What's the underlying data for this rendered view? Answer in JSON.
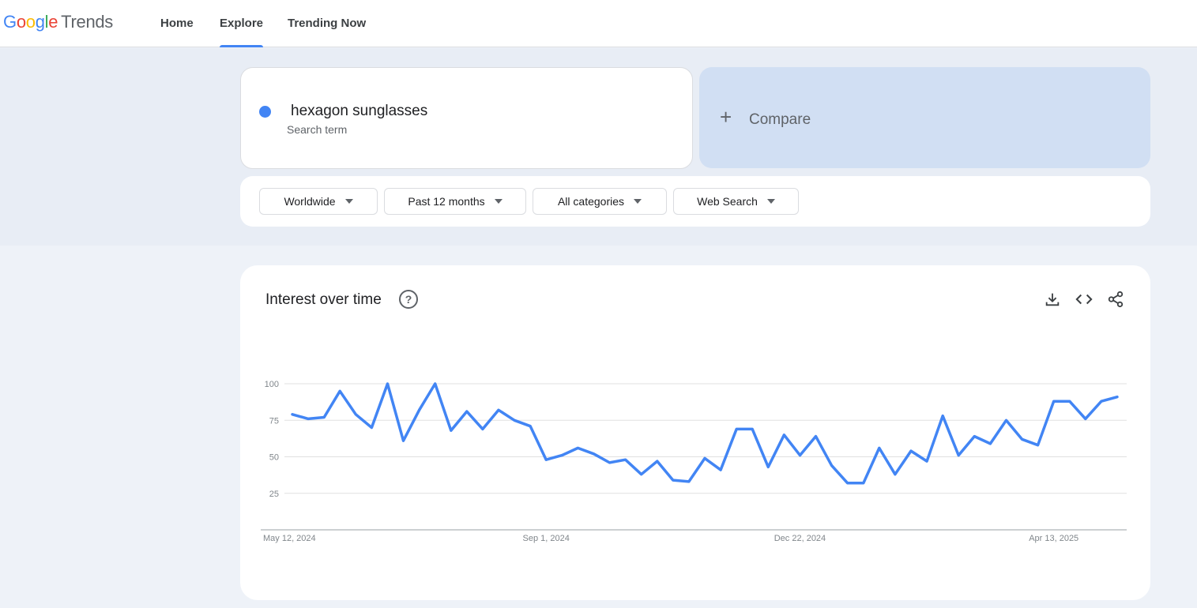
{
  "header": {
    "logo_google": "Google",
    "logo_trends": "Trends",
    "nav": [
      {
        "label": "Home",
        "active": false
      },
      {
        "label": "Explore",
        "active": true
      },
      {
        "label": "Trending Now",
        "active": false
      }
    ]
  },
  "search": {
    "term": "hexagon sunglasses",
    "term_type": "Search term",
    "term_color": "#4285f4",
    "compare_label": "Compare"
  },
  "filters": {
    "region": "Worldwide",
    "time": "Past 12 months",
    "category": "All categories",
    "property": "Web Search"
  },
  "chart_card": {
    "title": "Interest over time",
    "actions": [
      "download-icon",
      "embed-code-icon",
      "share-icon"
    ]
  },
  "chart_data": {
    "type": "line",
    "title": "Interest over time",
    "xlabel": "",
    "ylabel": "",
    "ylim": [
      0,
      100
    ],
    "y_ticks": [
      25,
      50,
      75,
      100
    ],
    "x_tick_labels": [
      "May 12, 2024",
      "Sep 1, 2024",
      "Dec 22, 2024",
      "Apr 13, 2025"
    ],
    "x_tick_indices": [
      0,
      16,
      32,
      48
    ],
    "grid": true,
    "series": [
      {
        "color": "#4285f4",
        "values": [
          79,
          76,
          77,
          95,
          79,
          70,
          100,
          61,
          82,
          100,
          68,
          81,
          69,
          82,
          75,
          71,
          48,
          51,
          56,
          52,
          46,
          48,
          38,
          47,
          34,
          33,
          49,
          41,
          69,
          69,
          43,
          65,
          51,
          64,
          44,
          32,
          32,
          56,
          38,
          54,
          47,
          78,
          51,
          64,
          59,
          75,
          62,
          58,
          88,
          88,
          76,
          88,
          91
        ]
      }
    ]
  }
}
